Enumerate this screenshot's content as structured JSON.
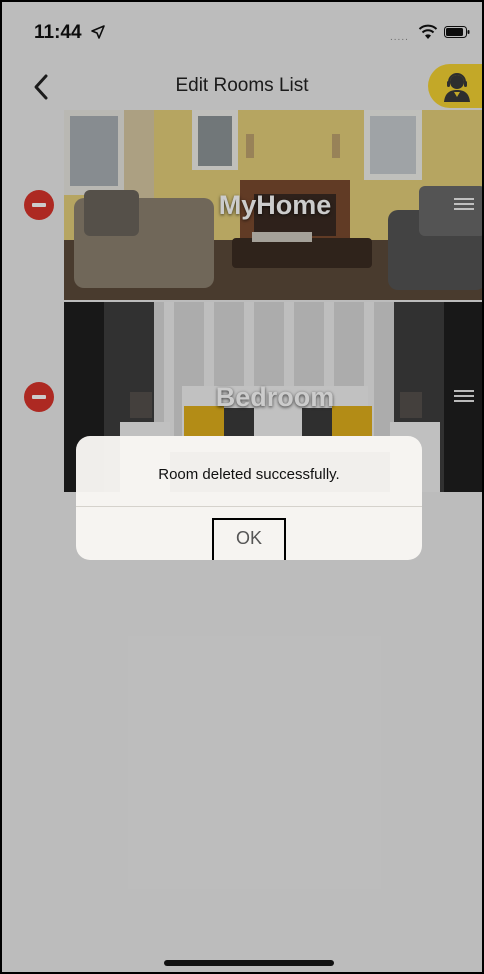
{
  "status_bar": {
    "time": "11:44",
    "location_icon": "location-arrow-icon",
    "signal_text": ".....",
    "wifi_icon": "wifi-icon",
    "battery_icon": "battery-icon"
  },
  "nav": {
    "title": "Edit Rooms List",
    "back_icon": "chevron-left-icon",
    "support_icon": "customer-support-icon",
    "accent_color": "#f4d232"
  },
  "rooms": [
    {
      "name": "MyHome",
      "delete_icon": "minus-circle-icon",
      "drag_icon": "drag-handle-icon"
    },
    {
      "name": "Bedroom",
      "delete_icon": "minus-circle-icon",
      "drag_icon": "drag-handle-icon"
    }
  ],
  "alert": {
    "message": "Room deleted successfully.",
    "ok_label": "OK"
  },
  "colors": {
    "delete_red": "#d9342b",
    "background": "#ececec"
  }
}
